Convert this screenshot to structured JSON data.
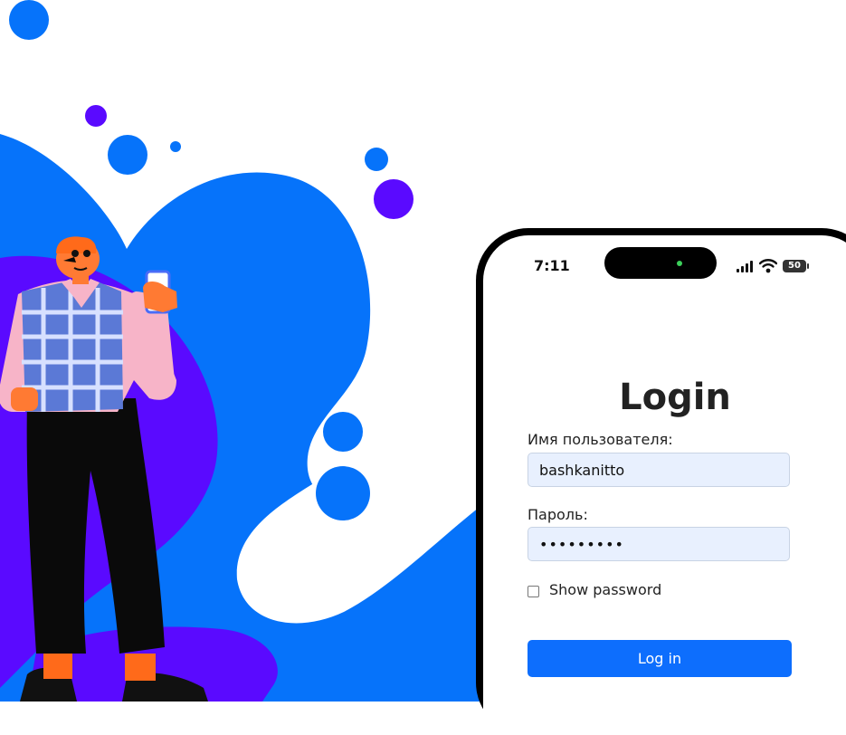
{
  "status_bar": {
    "time": "7:11",
    "battery": "50",
    "icons": [
      "cellular-signal-icon",
      "wifi-icon",
      "battery-icon"
    ]
  },
  "login": {
    "title": "Login",
    "username_label": "Имя пользователя:",
    "username_value": "bashkanitto",
    "password_label": "Пароль:",
    "password_value": "•••••••••",
    "show_password_label": "Show password",
    "show_password_checked": false,
    "submit_label": "Log in"
  },
  "colors": {
    "primary_blue": "#0d6efd",
    "blob_blue": "#0673fa",
    "blob_purple": "#5a0aff",
    "field_bg": "#e8f0fe",
    "shirt_pink": "#f7b4c8",
    "vest_blue": "#5b79d6"
  }
}
